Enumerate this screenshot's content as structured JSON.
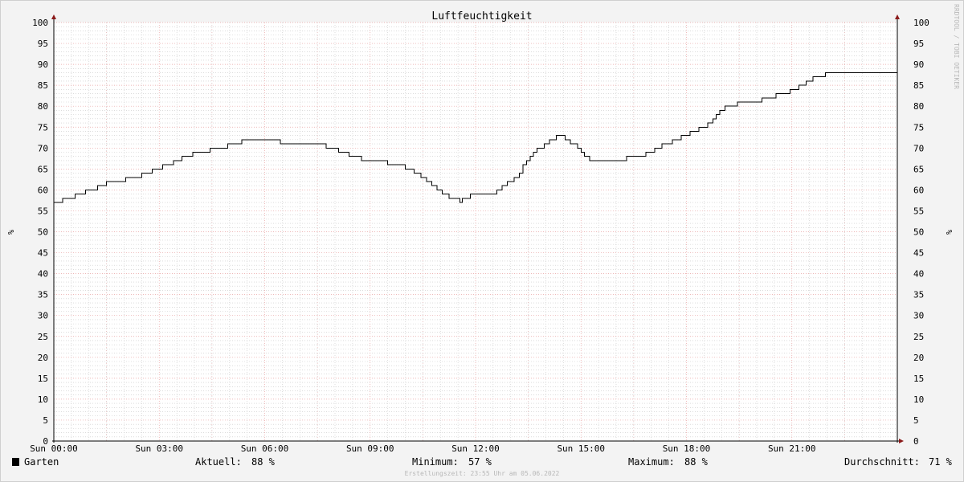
{
  "chart_data": {
    "type": "line",
    "title": "Luftfeuchtigkeit",
    "ylabel": "%",
    "ylim": [
      0,
      100
    ],
    "yticks": [
      0,
      5,
      10,
      15,
      20,
      25,
      30,
      35,
      40,
      45,
      50,
      55,
      60,
      65,
      70,
      75,
      80,
      85,
      90,
      95,
      100
    ],
    "xlim": [
      0,
      24
    ],
    "xticks": [
      {
        "hour": 0,
        "label": "Sun 00:00"
      },
      {
        "hour": 3,
        "label": "Sun 03:00"
      },
      {
        "hour": 6,
        "label": "Sun 06:00"
      },
      {
        "hour": 9,
        "label": "Sun 09:00"
      },
      {
        "hour": 12,
        "label": "Sun 12:00"
      },
      {
        "hour": 15,
        "label": "Sun 15:00"
      },
      {
        "hour": 18,
        "label": "Sun 18:00"
      },
      {
        "hour": 21,
        "label": "Sun 21:00"
      }
    ],
    "grid": true,
    "watermark": "RRDTOOL / TOBI OETIKER",
    "series": [
      {
        "name": "Garten",
        "color": "#000000",
        "points": [
          [
            0.0,
            57
          ],
          [
            0.25,
            58
          ],
          [
            0.6,
            59
          ],
          [
            0.9,
            60
          ],
          [
            1.25,
            61
          ],
          [
            1.5,
            62
          ],
          [
            2.05,
            63
          ],
          [
            2.5,
            64
          ],
          [
            2.8,
            65
          ],
          [
            3.1,
            66
          ],
          [
            3.4,
            67
          ],
          [
            3.65,
            68
          ],
          [
            3.95,
            69
          ],
          [
            4.45,
            70
          ],
          [
            4.95,
            71
          ],
          [
            5.35,
            72
          ],
          [
            6.45,
            71
          ],
          [
            7.75,
            70
          ],
          [
            8.1,
            69
          ],
          [
            8.4,
            68
          ],
          [
            8.75,
            67
          ],
          [
            9.5,
            66
          ],
          [
            10.0,
            65
          ],
          [
            10.25,
            64
          ],
          [
            10.45,
            63
          ],
          [
            10.6,
            62
          ],
          [
            10.75,
            61
          ],
          [
            10.9,
            60
          ],
          [
            11.05,
            59
          ],
          [
            11.25,
            58
          ],
          [
            11.55,
            57
          ],
          [
            11.62,
            58
          ],
          [
            11.85,
            59
          ],
          [
            12.6,
            60
          ],
          [
            12.75,
            61
          ],
          [
            12.9,
            62
          ],
          [
            13.1,
            63
          ],
          [
            13.25,
            64
          ],
          [
            13.35,
            66
          ],
          [
            13.45,
            67
          ],
          [
            13.55,
            68
          ],
          [
            13.65,
            69
          ],
          [
            13.75,
            70
          ],
          [
            13.95,
            71
          ],
          [
            14.1,
            72
          ],
          [
            14.3,
            73
          ],
          [
            14.55,
            72
          ],
          [
            14.7,
            71
          ],
          [
            14.9,
            70
          ],
          [
            15.0,
            69
          ],
          [
            15.1,
            68
          ],
          [
            15.25,
            67
          ],
          [
            16.3,
            68
          ],
          [
            16.85,
            69
          ],
          [
            17.1,
            70
          ],
          [
            17.3,
            71
          ],
          [
            17.6,
            72
          ],
          [
            17.85,
            73
          ],
          [
            18.1,
            74
          ],
          [
            18.35,
            75
          ],
          [
            18.6,
            76
          ],
          [
            18.75,
            77
          ],
          [
            18.85,
            78
          ],
          [
            18.95,
            79
          ],
          [
            19.1,
            80
          ],
          [
            19.45,
            81
          ],
          [
            20.15,
            82
          ],
          [
            20.55,
            83
          ],
          [
            20.95,
            84
          ],
          [
            21.2,
            85
          ],
          [
            21.4,
            86
          ],
          [
            21.6,
            87
          ],
          [
            21.95,
            88
          ],
          [
            24.0,
            88
          ]
        ]
      }
    ]
  },
  "legend": {
    "series_name": "Garten",
    "swatch_color": "#000000",
    "aktuell_label": "Aktuell:",
    "aktuell_value": "88 %",
    "minimum_label": "Minimum:",
    "minimum_value": "57 %",
    "maximum_label": "Maximum:",
    "maximum_value": "88 %",
    "durchschnitt_label": "Durchschnitt:",
    "durchschnitt_value": "71 %"
  },
  "footer": "Erstellungszeit: 23:55 Uhr am 05.06.2022",
  "colors": {
    "background": "#f3f3f3",
    "canvas": "#ffffff",
    "major_grid": "#e8a0a0",
    "minor_grid": "#c8c8c8",
    "axis": "#000000",
    "arrow": "#8b1a1a"
  }
}
